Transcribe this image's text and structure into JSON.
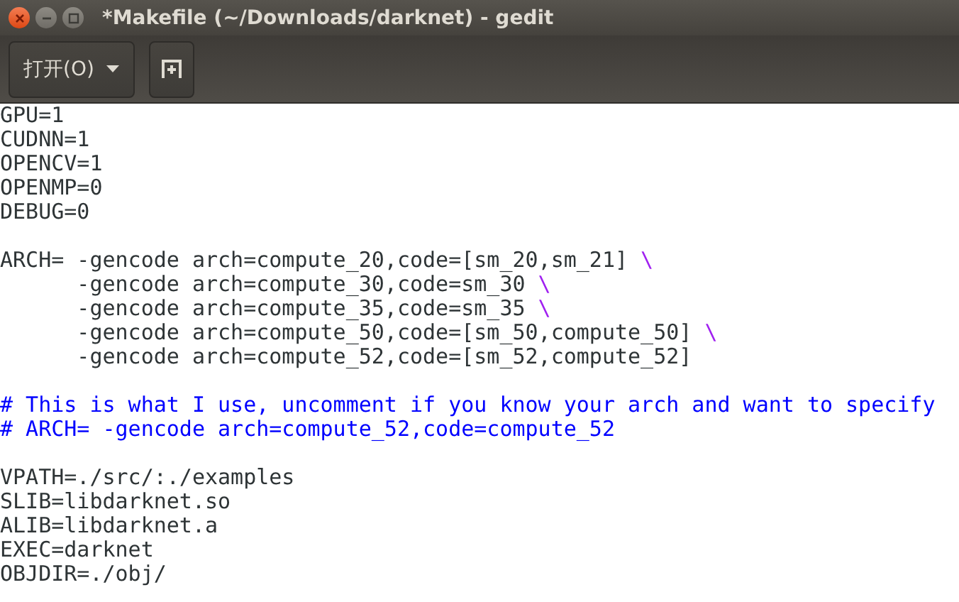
{
  "window": {
    "title": "*Makefile (~/Downloads/darknet) - gedit"
  },
  "toolbar": {
    "open_button": {
      "label": "打开(O)"
    }
  },
  "editor": {
    "lines": [
      {
        "kind": "code",
        "segments": [
          {
            "kind": "plain",
            "text": "GPU=1"
          }
        ]
      },
      {
        "kind": "code",
        "segments": [
          {
            "kind": "plain",
            "text": "CUDNN=1"
          }
        ]
      },
      {
        "kind": "code",
        "segments": [
          {
            "kind": "plain",
            "text": "OPENCV=1"
          }
        ]
      },
      {
        "kind": "code",
        "segments": [
          {
            "kind": "plain",
            "text": "OPENMP=0"
          }
        ]
      },
      {
        "kind": "code",
        "segments": [
          {
            "kind": "plain",
            "text": "DEBUG=0"
          }
        ]
      },
      {
        "kind": "blank"
      },
      {
        "kind": "code",
        "segments": [
          {
            "kind": "plain",
            "text": "ARCH= -gencode arch=compute_20,code=[sm_20,sm_21] "
          },
          {
            "kind": "escape",
            "text": "\\"
          }
        ]
      },
      {
        "kind": "code",
        "segments": [
          {
            "kind": "plain",
            "text": "      -gencode arch=compute_30,code=sm_30 "
          },
          {
            "kind": "escape",
            "text": "\\"
          }
        ]
      },
      {
        "kind": "code",
        "segments": [
          {
            "kind": "plain",
            "text": "      -gencode arch=compute_35,code=sm_35 "
          },
          {
            "kind": "escape",
            "text": "\\"
          }
        ]
      },
      {
        "kind": "code",
        "segments": [
          {
            "kind": "plain",
            "text": "      -gencode arch=compute_50,code=[sm_50,compute_50] "
          },
          {
            "kind": "escape",
            "text": "\\"
          }
        ]
      },
      {
        "kind": "code",
        "segments": [
          {
            "kind": "plain",
            "text": "      -gencode arch=compute_52,code=[sm_52,compute_52]"
          }
        ]
      },
      {
        "kind": "blank"
      },
      {
        "kind": "code",
        "segments": [
          {
            "kind": "comment",
            "text": "# This is what I use, uncomment if you know your arch and want to specify"
          }
        ]
      },
      {
        "kind": "code",
        "segments": [
          {
            "kind": "comment",
            "text": "# ARCH= -gencode arch=compute_52,code=compute_52"
          }
        ]
      },
      {
        "kind": "blank"
      },
      {
        "kind": "code",
        "segments": [
          {
            "kind": "plain",
            "text": "VPATH=./src/:./examples"
          }
        ]
      },
      {
        "kind": "code",
        "segments": [
          {
            "kind": "plain",
            "text": "SLIB=libdarknet.so"
          }
        ]
      },
      {
        "kind": "code",
        "segments": [
          {
            "kind": "plain",
            "text": "ALIB=libdarknet.a"
          }
        ]
      },
      {
        "kind": "code",
        "segments": [
          {
            "kind": "plain",
            "text": "EXEC=darknet"
          }
        ]
      },
      {
        "kind": "code",
        "segments": [
          {
            "kind": "plain",
            "text": "OBJDIR=./obj/"
          }
        ]
      }
    ]
  }
}
